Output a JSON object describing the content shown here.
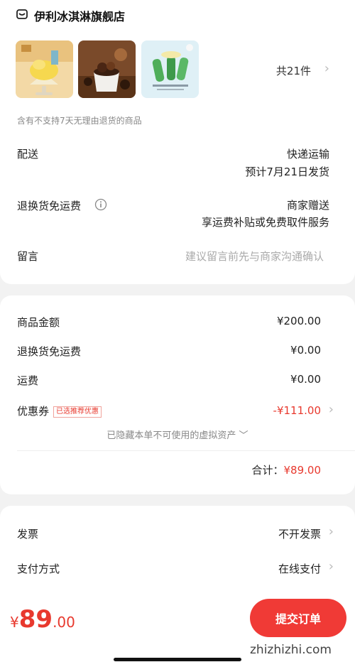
{
  "store": {
    "name": "伊利冰淇淋旗舰店",
    "item_count": "共21件",
    "notice": "含有不支持7天无理由退货的商品",
    "icons": [
      "shop-icon",
      "chevron-right-icon"
    ]
  },
  "delivery": {
    "label": "配送",
    "method": "快递运输",
    "estimate": "预计7月21日发货"
  },
  "return_shipping": {
    "label": "退换货免运费",
    "value": "商家赠送",
    "sub": "享运费补贴或免费取件服务"
  },
  "message": {
    "label": "留言",
    "placeholder": "建议留言前先与商家沟通确认"
  },
  "pricing": {
    "goods_label": "商品金额",
    "goods_value": "¥200.00",
    "return_label": "退换货免运费",
    "return_value": "¥0.00",
    "shipping_label": "运费",
    "shipping_value": "¥0.00",
    "coupon_label": "优惠券",
    "coupon_tag": "已选推荐优惠",
    "coupon_value": "-¥111.00",
    "hidden_assets": "已隐藏本单不可使用的虚拟资产 ﹀",
    "total_label": "合计：",
    "total_value": "¥89.00"
  },
  "invoice": {
    "label": "发票",
    "value": "不开发票"
  },
  "payment": {
    "label": "支付方式",
    "value": "在线支付"
  },
  "checkout": {
    "currency": "¥",
    "integer": "89",
    "decimal": ".00",
    "button_label": "提交订单"
  },
  "watermark": "zhizhizhi.com",
  "colors": {
    "accent": "#e8392e",
    "button": "#f03a36"
  }
}
